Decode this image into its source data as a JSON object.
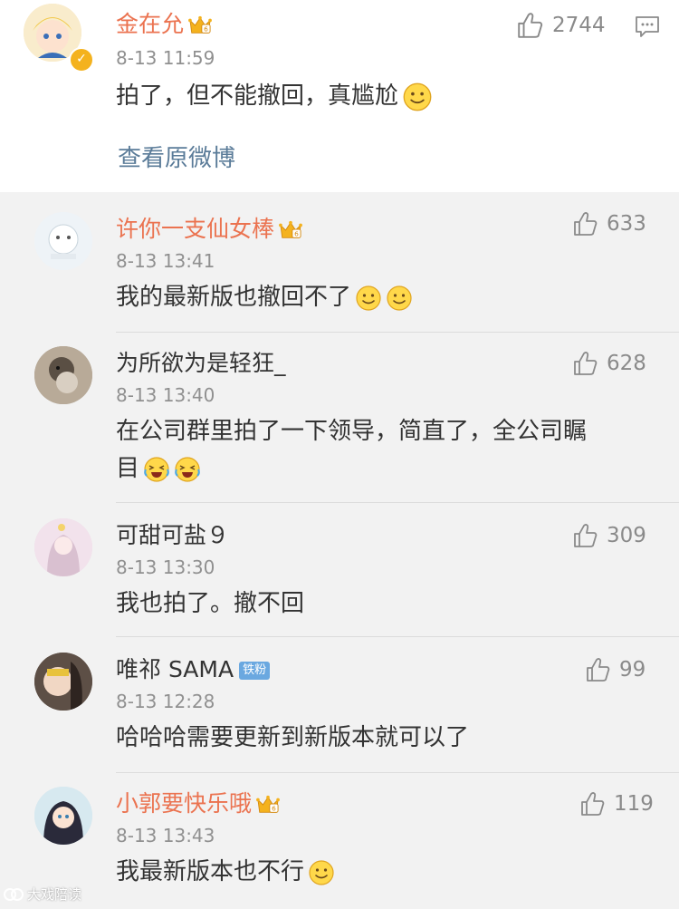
{
  "main_comment": {
    "user": "金在允",
    "time": "8-13 11:59",
    "text": "拍了，但不能撤回，真尴尬",
    "likes": "2744",
    "view_original": "查看原微博"
  },
  "replies": [
    {
      "user": "许你一支仙女棒",
      "time": "8-13 13:41",
      "text": "我的最新版也撤回不了",
      "likes": "633"
    },
    {
      "user": "为所欲为是轻狂_",
      "time": "8-13 13:40",
      "text_line1": "在公司群里拍了一下领导，简直了，全公司瞩",
      "text_line2": "目",
      "likes": "628"
    },
    {
      "user": "可甜可盐９",
      "time": "8-13 13:30",
      "text": "我也拍了。撤不回",
      "likes": "309"
    },
    {
      "user": "唯祁 SAMA",
      "badge": "铁粉",
      "time": "8-13 12:28",
      "text": "哈哈哈需要更新到新版本就可以了",
      "likes": "99"
    },
    {
      "user": "小郭要快乐哦",
      "time": "8-13 13:43",
      "text": "我最新版本也不行",
      "likes": "119"
    }
  ],
  "watermark": "大戏陪读",
  "colors": {
    "vip_name": "#eb7350",
    "link": "#5b7c99",
    "muted": "#909090",
    "reply_bg": "#f2f2f2"
  }
}
